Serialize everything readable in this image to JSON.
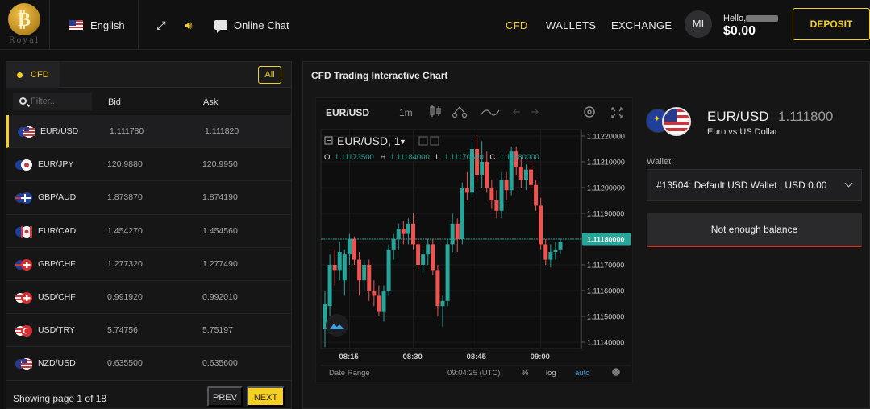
{
  "brand": {
    "logo_letter": "₿",
    "logo_text": "Royal"
  },
  "header": {
    "language": "English",
    "chat_label": "Online Chat",
    "nav": {
      "cfd": "CFD",
      "wallets": "WALLETS",
      "exchange": "EXCHANGE"
    },
    "avatar_initials": "MI",
    "hello": "Hello,",
    "balance": "$0.00",
    "deposit_label": "DEPOSIT",
    "colors": {
      "accent": "#f5d020"
    }
  },
  "instruments": {
    "tab_label": "CFD",
    "all_label": "All",
    "filter_placeholder": "Filter...",
    "columns": {
      "bid": "Bid",
      "ask": "Ask"
    },
    "rows": [
      {
        "symbol": "EUR/USD",
        "bid": "1.111780",
        "ask": "1.111820"
      },
      {
        "symbol": "EUR/JPY",
        "bid": "120.9880",
        "ask": "120.9950"
      },
      {
        "symbol": "GBP/AUD",
        "bid": "1.873870",
        "ask": "1.874190"
      },
      {
        "symbol": "EUR/CAD",
        "bid": "1.454270",
        "ask": "1.454560"
      },
      {
        "symbol": "GBP/CHF",
        "bid": "1.277320",
        "ask": "1.277490"
      },
      {
        "symbol": "USD/CHF",
        "bid": "0.991920",
        "ask": "0.992010"
      },
      {
        "symbol": "USD/TRY",
        "bid": "5.74756",
        "ask": "5.75197"
      },
      {
        "symbol": "NZD/USD",
        "bid": "0.635500",
        "ask": "0.635600"
      }
    ],
    "page_info": "Showing page 1 of 18",
    "prev_label": "PREV",
    "next_label": "NEXT"
  },
  "chart_panel": {
    "title": "CFD Trading Interactive Chart",
    "toolbar": {
      "symbol": "EUR/USD",
      "interval": "1m"
    },
    "legend": {
      "title": "EUR/USD, 1",
      "o_label": "O",
      "o_value": "1.11173500",
      "h_label": "H",
      "h_value": "1.11184000",
      "l_label": "L",
      "l_value": "1.11170500",
      "c_label": "C",
      "c_value": "1.11180000"
    },
    "footer": {
      "date_range": "Date Range",
      "clock": "09:04:25 (UTC)",
      "percent": "%",
      "log": "log",
      "auto": "auto"
    },
    "colors": {
      "up": "#26a69a",
      "down": "#ef5350",
      "last_price_bg": "#26a69a"
    }
  },
  "chart_data": {
    "type": "candlestick",
    "y_ticks": [
      "1.11220000",
      "1.11210000",
      "1.11200000",
      "1.11190000",
      "1.11180000",
      "1.11170000",
      "1.11160000",
      "1.11150000",
      "1.11140000"
    ],
    "ylim": [
      1.111375,
      1.112225
    ],
    "x_ticks": [
      "08:15",
      "08:30",
      "08:45",
      "09:00"
    ],
    "last_price": "1.11180000",
    "candles": [
      [
        1.11145,
        1.1116,
        1.11138,
        1.11155
      ],
      [
        1.11154,
        1.11174,
        1.1115,
        1.1117
      ],
      [
        1.1117,
        1.11176,
        1.11162,
        1.11168
      ],
      [
        1.11168,
        1.11179,
        1.11164,
        1.11175
      ],
      [
        1.11164,
        1.11176,
        1.11158,
        1.11174
      ],
      [
        1.11174,
        1.11182,
        1.1117,
        1.1118
      ],
      [
        1.1118,
        1.11181,
        1.1117,
        1.11172
      ],
      [
        1.11172,
        1.11175,
        1.11158,
        1.11164
      ],
      [
        1.11164,
        1.11172,
        1.1116,
        1.1117
      ],
      [
        1.1117,
        1.11172,
        1.11156,
        1.1116
      ],
      [
        1.1116,
        1.11164,
        1.11154,
        1.11158
      ],
      [
        1.11158,
        1.11162,
        1.1115,
        1.11152
      ],
      [
        1.11152,
        1.11162,
        1.11148,
        1.1116
      ],
      [
        1.1116,
        1.11178,
        1.11158,
        1.11176
      ],
      [
        1.11176,
        1.11182,
        1.11172,
        1.1118
      ],
      [
        1.1118,
        1.11186,
        1.11176,
        1.11184
      ],
      [
        1.11184,
        1.11187,
        1.11178,
        1.11182
      ],
      [
        1.11182,
        1.11188,
        1.11178,
        1.11186
      ],
      [
        1.11186,
        1.1119,
        1.11176,
        1.11178
      ],
      [
        1.11178,
        1.1118,
        1.11168,
        1.1117
      ],
      [
        1.1117,
        1.11176,
        1.11167,
        1.11174
      ],
      [
        1.11174,
        1.1118,
        1.1117,
        1.11178
      ],
      [
        1.11178,
        1.1118,
        1.11166,
        1.11168
      ],
      [
        1.11168,
        1.1117,
        1.1115,
        1.11154
      ],
      [
        1.11154,
        1.11158,
        1.11146,
        1.11156
      ],
      [
        1.11156,
        1.1118,
        1.11154,
        1.11178
      ],
      [
        1.11178,
        1.1119,
        1.11175,
        1.11186
      ],
      [
        1.11186,
        1.11188,
        1.11175,
        1.1118
      ],
      [
        1.1118,
        1.11202,
        1.11178,
        1.112
      ],
      [
        1.112,
        1.11206,
        1.11195,
        1.11198
      ],
      [
        1.11198,
        1.11218,
        1.11196,
        1.11215
      ],
      [
        1.11215,
        1.1122,
        1.11202,
        1.11205
      ],
      [
        1.11205,
        1.11218,
        1.112,
        1.1121
      ],
      [
        1.1121,
        1.11214,
        1.11198,
        1.112
      ],
      [
        1.112,
        1.11203,
        1.11192,
        1.11195
      ],
      [
        1.11195,
        1.11199,
        1.11188,
        1.11191
      ],
      [
        1.11191,
        1.11206,
        1.11188,
        1.11203
      ],
      [
        1.11203,
        1.11206,
        1.11195,
        1.11199
      ],
      [
        1.11199,
        1.11216,
        1.11197,
        1.11214
      ],
      [
        1.11214,
        1.11216,
        1.11205,
        1.11208
      ],
      [
        1.11208,
        1.11212,
        1.112,
        1.11203
      ],
      [
        1.11203,
        1.11209,
        1.11199,
        1.11207
      ],
      [
        1.11207,
        1.1121,
        1.11199,
        1.11201
      ],
      [
        1.11201,
        1.11203,
        1.11191,
        1.11193
      ],
      [
        1.11193,
        1.11196,
        1.11176,
        1.11178
      ],
      [
        1.11178,
        1.1118,
        1.1117,
        1.11172
      ],
      [
        1.11172,
        1.11178,
        1.11169,
        1.11175
      ],
      [
        1.11175,
        1.11179,
        1.11172,
        1.11176
      ],
      [
        1.11176,
        1.1118,
        1.11174,
        1.11179
      ]
    ]
  },
  "order_panel": {
    "pair": "EUR/USD",
    "price": "1.111800",
    "description": "Euro vs US Dollar",
    "wallet_label": "Wallet:",
    "wallet_value": "#13504: Default USD Wallet | USD 0.00",
    "balance_button": "Not enough balance"
  }
}
